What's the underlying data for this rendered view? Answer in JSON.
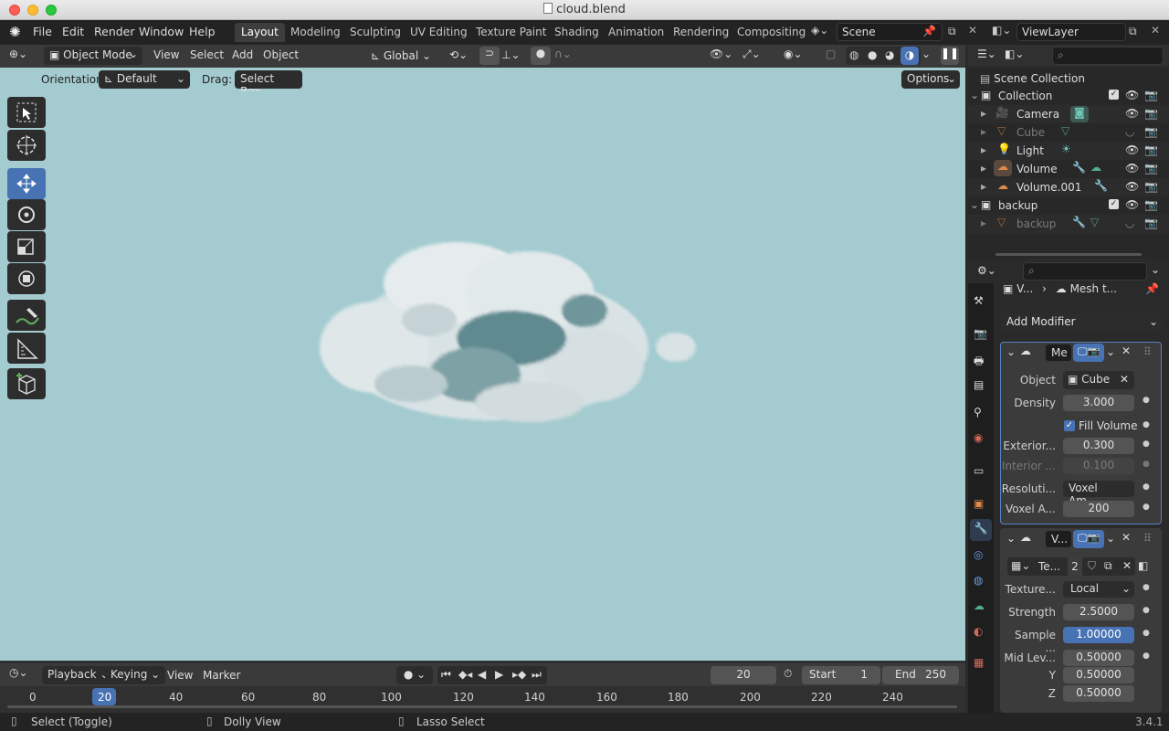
{
  "window": {
    "title": "cloud.blend"
  },
  "menu": [
    "File",
    "Edit",
    "Render",
    "Window",
    "Help"
  ],
  "workspaces": [
    "Layout",
    "Modeling",
    "Sculpting",
    "UV Editing",
    "Texture Paint",
    "Shading",
    "Animation",
    "Rendering",
    "Compositing"
  ],
  "active_workspace": "Layout",
  "scene": "Scene",
  "view_layer": "ViewLayer",
  "viewport": {
    "mode": "Object Mode",
    "menus": [
      "View",
      "Select",
      "Add",
      "Object"
    ],
    "transform_orientation": "Global",
    "orientation_label": "Orientation:",
    "orientation_value": "Default",
    "drag_label": "Drag:",
    "drag_value": "Select Box",
    "options": "Options"
  },
  "timeline": {
    "playback": "Playback",
    "keying": "Keying",
    "view": "View",
    "marker": "Marker",
    "current_frame": "20",
    "start_label": "Start",
    "start": "1",
    "end_label": "End",
    "end": "250",
    "ticks": [
      "0",
      "20",
      "40",
      "60",
      "80",
      "100",
      "120",
      "140",
      "160",
      "180",
      "200",
      "220",
      "240"
    ]
  },
  "outliner": {
    "title": "Scene Collection",
    "items": [
      {
        "name": "Collection"
      },
      {
        "name": "Camera"
      },
      {
        "name": "Cube"
      },
      {
        "name": "Light"
      },
      {
        "name": "Volume"
      },
      {
        "name": "Volume.001"
      },
      {
        "name": "backup"
      },
      {
        "name": "backup"
      }
    ]
  },
  "properties": {
    "breadcrumb_obj": "V...",
    "breadcrumb_mod": "Mesh t...",
    "add_modifier": "Add Modifier",
    "mod1": {
      "name": "Me",
      "object_label": "Object",
      "object_value": "Cube",
      "density_label": "Density",
      "density": "3.000",
      "fill_volume": "Fill Volume",
      "exterior_label": "Exterior...",
      "exterior": "0.300",
      "interior_label": "Interior ...",
      "interior": "0.100",
      "resolution_label": "Resoluti...",
      "resolution": "Voxel Am...",
      "voxel_label": "Voxel A...",
      "voxel": "200"
    },
    "mod2": {
      "name": "V...",
      "texture": "Te...",
      "users": "2",
      "texture_label": "Texture...",
      "texture_coords": "Local",
      "strength_label": "Strength",
      "strength": "2.5000",
      "sample_label": "Sample ...",
      "sample": "1.00000",
      "midlevel_label": "Mid Lev...",
      "midlevel_x": "0.50000",
      "y_label": "Y",
      "midlevel_y": "0.50000",
      "z_label": "Z",
      "midlevel_z": "0.50000"
    }
  },
  "status": {
    "select": "Select (Toggle)",
    "dolly": "Dolly View",
    "lasso": "Lasso Select",
    "version": "3.4.1"
  }
}
